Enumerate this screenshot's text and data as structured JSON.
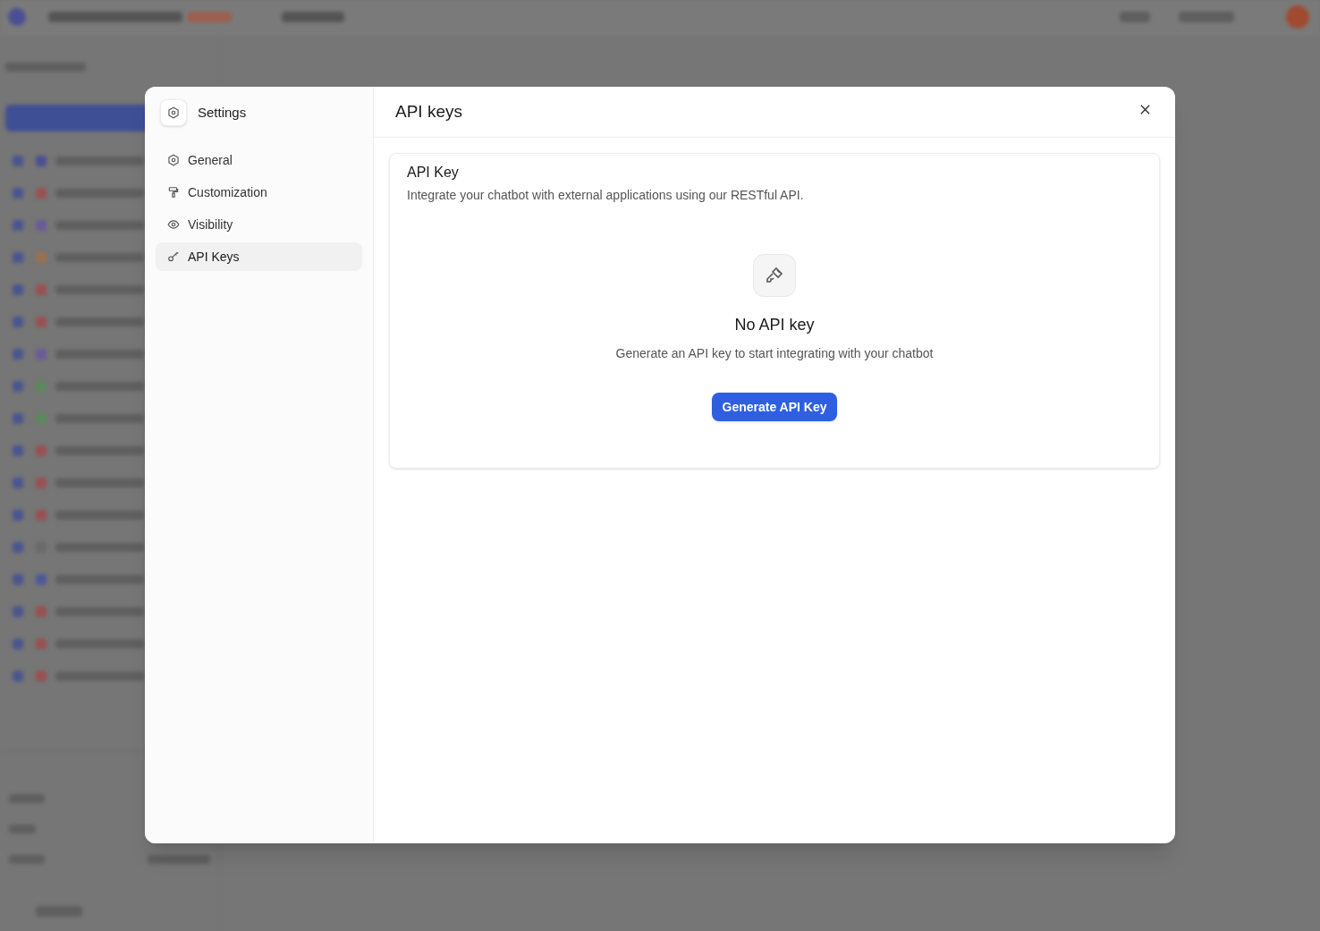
{
  "dialog": {
    "title": "API keys",
    "sidebar": {
      "title": "Settings",
      "items": [
        {
          "kind": "general",
          "label": "General",
          "selected": false
        },
        {
          "kind": "customization",
          "label": "Customization",
          "selected": false
        },
        {
          "kind": "visibility",
          "label": "Visibility",
          "selected": false
        },
        {
          "kind": "api",
          "label": "API Keys",
          "selected": true
        }
      ]
    },
    "card": {
      "title": "API Key",
      "description": "Integrate your chatbot with external applications using our RESTful API.",
      "empty_title": "No API key",
      "empty_text": "Generate an API key to start integrating with your chatbot",
      "button": "Generate API Key"
    }
  }
}
